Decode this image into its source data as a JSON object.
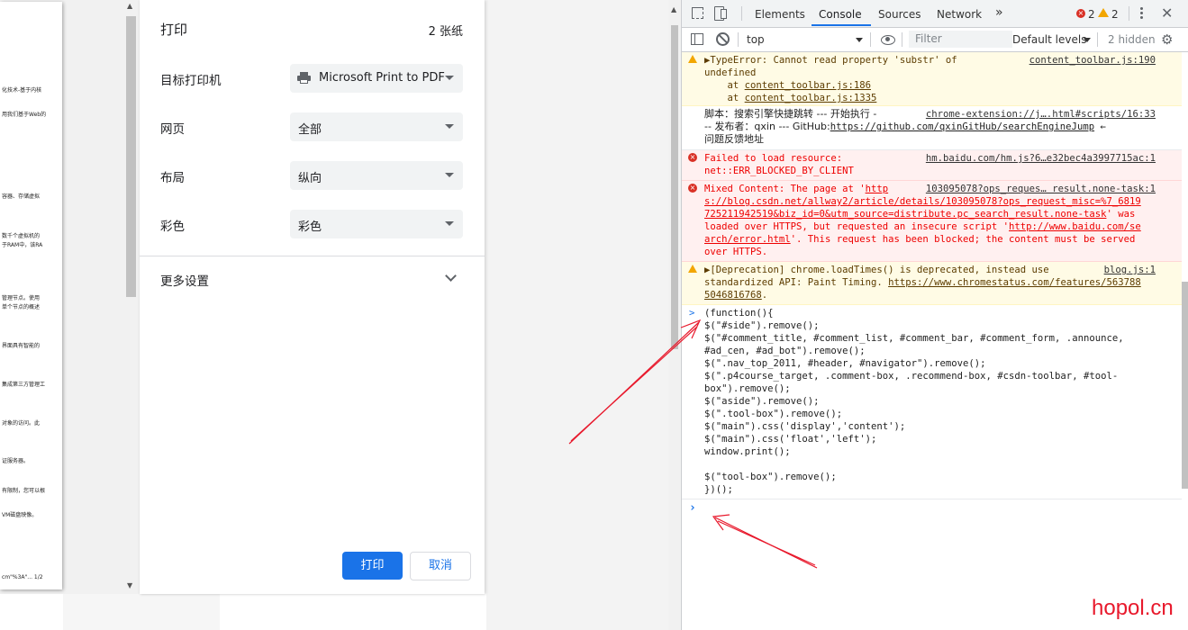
{
  "preview": {
    "lines": [
      "化技术-基于内核",
      "用我们基于Web的",
      "容器、存储虚拟",
      "数千个虚拟机的",
      "于RAM中，该RA",
      "管理节点。使用",
      "单个节点的概述",
      "界面具有智能的",
      "集成第三方管理工",
      "对象的访问。此",
      "证服务器。",
      "有限制，您可以根",
      "VM磁盘映像。",
      "cm\"%3A\"...   1/2"
    ]
  },
  "print_dialog": {
    "title": "打印",
    "sheet_count": "2 张纸",
    "rows": [
      {
        "label": "目标打印机",
        "value": "Microsoft Print to PDF"
      },
      {
        "label": "网页",
        "value": "全部"
      },
      {
        "label": "布局",
        "value": "纵向"
      },
      {
        "label": "彩色",
        "value": "彩色"
      }
    ],
    "more_settings": "更多设置",
    "print_button": "打印",
    "cancel_button": "取消"
  },
  "devtools": {
    "tabs": [
      "Elements",
      "Console",
      "Sources",
      "Network"
    ],
    "more_tabs": "»",
    "active_tab": "Console",
    "error_count": "2",
    "warning_count": "2",
    "context": "top",
    "filter_placeholder": "Filter",
    "levels": "Default levels",
    "hidden": "2 hidden",
    "messages": {
      "m1_text": "▶TypeError: Cannot read property 'substr' of\nundefined",
      "m1_src": "content_toolbar.js:190",
      "m1_at1_prefix": "    at ",
      "m1_at1": "content_toolbar.js:186",
      "m1_at2_prefix": "    at ",
      "m1_at2": "content_toolbar.js:1335",
      "m2_text1": "脚本：搜索引擎快捷跳转 --- 开始执行 -",
      "m2_src": "chrome-extension://j….html#scripts/16:33",
      "m2_text2": "-- 发布者：qxin --- GitHub:",
      "m2_link": "https://github.com/qxinGitHub/searchEngineJump",
      "m2_text3": " ←",
      "m2_text4": "问题反馈地址",
      "m3_text": "Failed to load resource:\nnet::ERR_BLOCKED_BY_CLIENT",
      "m3_src": "hm.baidu.com/hm.js?6…e32bec4a3997715ac:1",
      "m4_src": "103095078?ops_reques… result.none-task:1",
      "m4_l1a": "Mixed Content: The page at '",
      "m4_l1b": "http",
      "m4_l2": "s://blog.csdn.net/allway2/article/details/103095078?ops_request_misc=%7_6819",
      "m4_l3a": "725211942519&biz_id=0&utm_source=distribute.pc_search_result.none-task",
      "m4_l3b": "' was",
      "m4_l4a": "loaded over HTTPS, but requested an insecure script '",
      "m4_l4b": "http://www.baidu.com/se",
      "m4_l5a": "arch/error.html",
      "m4_l5b": "'. This request has been blocked; the content must be served",
      "m4_l6": "over HTTPS.",
      "m5_l1": "▶[Deprecation] chrome.loadTimes() is deprecated, instead use",
      "m5_src": "blog.js:1",
      "m5_l2a": "standardized API: Paint Timing. ",
      "m5_l2b": "https://www.chromestatus.com/features/563788",
      "m5_l3": "5046816768",
      "m5_l3b": ".",
      "code": [
        "(function(){",
        "$(\"#side\").remove();",
        "$(\"#comment_title, #comment_list, #comment_bar, #comment_form, .announce,",
        "#ad_cen, #ad_bot\").remove();",
        "$(\".nav_top_2011, #header, #navigator\").remove();",
        "$(\".p4course_target, .comment-box, .recommend-box, #csdn-toolbar, #tool-",
        "box\").remove();",
        "$(\"aside\").remove();",
        "$(\".tool-box\").remove();",
        "$(\"main\").css('display','content');",
        "$(\"main\").css('float','left');",
        "window.print();",
        "",
        "$(\"tool-box\").remove();",
        "})();"
      ],
      "prompt_in": ">",
      "prompt_cursor": "›"
    }
  },
  "watermark": "hopol.cn",
  "colors": {
    "accent": "#1a73e8",
    "error": "#d93025",
    "warning": "#f2a600",
    "arrow": "#e8192c"
  }
}
